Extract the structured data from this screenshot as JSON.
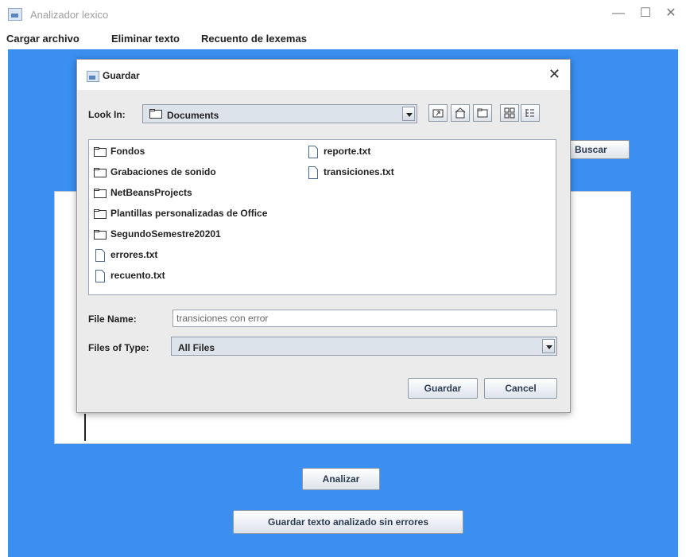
{
  "app": {
    "title": "Analizador lexico",
    "controls": {
      "minimize": "—",
      "maximize": "☐",
      "close": "✕"
    }
  },
  "menu": [
    "Cargar archivo",
    "Eliminar texto",
    "Recuento de lexemas"
  ],
  "main": {
    "search_button": "Buscar",
    "analyze_button": "Analizar",
    "save_button": "Guardar texto analizado sin errores"
  },
  "dialog": {
    "title": "Guardar",
    "close": "✕",
    "look_in_label": "Look In:",
    "look_in_value": "Documents",
    "files": [
      {
        "name": "Fondos",
        "type": "folder"
      },
      {
        "name": "Grabaciones de sonido",
        "type": "folder"
      },
      {
        "name": "NetBeansProjects",
        "type": "folder"
      },
      {
        "name": "Plantillas personalizadas de Office",
        "type": "folder"
      },
      {
        "name": "SegundoSemestre20201",
        "type": "folder"
      },
      {
        "name": "errores.txt",
        "type": "file"
      },
      {
        "name": "recuento.txt",
        "type": "file"
      },
      {
        "name": "reporte.txt",
        "type": "file"
      },
      {
        "name": "transiciones.txt",
        "type": "file"
      }
    ],
    "file_name_label": "File Name:",
    "file_name_value": "transiciones con error",
    "file_type_label": "Files of Type:",
    "file_type_value": "All Files",
    "save_button": "Guardar",
    "cancel_button": "Cancel"
  },
  "colors": {
    "background": "#3a8ff1",
    "dialog": "#ebebeb"
  }
}
